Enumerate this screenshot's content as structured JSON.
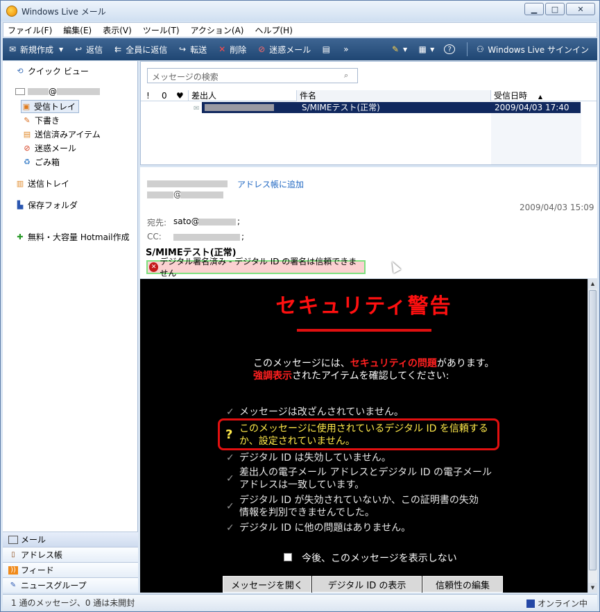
{
  "window": {
    "title": "Windows Live メール",
    "btn_min": "▁",
    "btn_max": "□",
    "btn_close": "✕"
  },
  "menu": [
    "ファイル(F)",
    "編集(E)",
    "表示(V)",
    "ツール(T)",
    "アクション(A)",
    "ヘルプ(H)"
  ],
  "toolbar": {
    "new": "新規作成",
    "reply": "返信",
    "reply_all": "全員に返信",
    "forward": "転送",
    "delete": "削除",
    "junk": "迷惑メール",
    "more": "»",
    "signin": "Windows Live サインイン"
  },
  "folders": {
    "quick_view": "クイック ビュー",
    "account": "@",
    "inbox": "受信トレイ",
    "drafts": "下書き",
    "sent": "送信済みアイテム",
    "junk": "迷惑メール",
    "trash": "ごみ箱",
    "outbox": "送信トレイ",
    "storage": "保存フォルダ",
    "hotmail": "無料・大容量 Hotmail作成"
  },
  "nav": {
    "mail": "メール",
    "contacts": "アドレス帳",
    "feeds": "フィード",
    "newsgroups": "ニュースグループ"
  },
  "list": {
    "search_placeholder": "メッセージの検索",
    "col_flag1": "!",
    "col_flag2": "0",
    "col_flag3": "♥",
    "col_from": "差出人",
    "col_subject": "件名",
    "col_date": "受信日時",
    "sort_arrow": "▲",
    "row_subject": "S/MIMEテスト(正常)",
    "row_date": "2009/04/03 17:40"
  },
  "preview": {
    "add_contact": "アドレス帳に追加",
    "from_at": "@",
    "date": "2009/04/03 15:09",
    "to_label": "宛先:",
    "to_value": "sato@",
    "to_end": ";",
    "cc_label": "CC:",
    "cc_end": ";",
    "subject": "S/MIMEテスト(正常)",
    "signature_status": "デジタル署名済み - デジタル ID の署名は信頼できません"
  },
  "warning": {
    "title": "セキュリティ警告",
    "line1_pre": "このメッセージには、",
    "line1_red": "セキュリティの問題",
    "line1_post": "があります。",
    "line2_red": "強調表示",
    "line2_post": "されたアイテムを確認してください:",
    "items": [
      "メッセージは改ざんされていません。",
      "このメッセージに使用されているデジタル ID を信頼する",
      "か、設定されていません。",
      "デジタル ID は失効していません。",
      "差出人の電子メール アドレスとデジタル ID の電子メール",
      "アドレスは一致しています。",
      "デジタル ID が失効されていないか、この証明書の失効",
      "情報を判別できませんでした。",
      "デジタル ID に他の問題はありません。"
    ],
    "question_mark": "?",
    "checkmark": "✓",
    "dont_show": "今後、このメッセージを表示しない",
    "btn_open": "メッセージを開く",
    "btn_show_id": "デジタル ID の表示",
    "btn_edit_trust": "信頼性の編集"
  },
  "status": {
    "message_count": "1 通のメッセージ、0 通は未開封",
    "online": "オンライン中"
  }
}
